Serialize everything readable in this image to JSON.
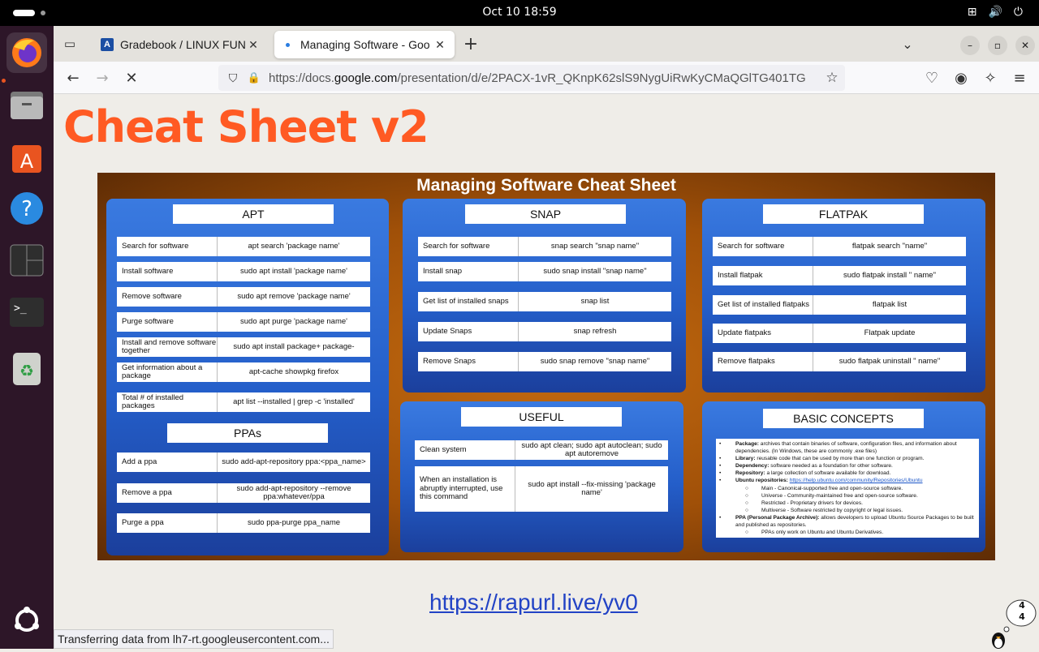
{
  "topbar": {
    "clock": "Oct 10  18:59"
  },
  "dock": {
    "apps": [
      "firefox-icon",
      "files-icon",
      "app-center-icon",
      "help-icon",
      "terminal-split-icon",
      "terminal-icon",
      "trash-icon",
      "ubuntu-grid-icon"
    ]
  },
  "browser": {
    "tabs": [
      {
        "title": "Gradebook / LINUX FUND",
        "close": "✕"
      },
      {
        "title": "Managing Software - Goo",
        "close": "✕"
      }
    ],
    "url_prefix": "https://docs.",
    "url_host": "google.com",
    "url_rest": "/presentation/d/e/2PACX-1vR_QKnpK62slS9NygUiRwKyCMaQGlTG401TG"
  },
  "slide": {
    "title": "Cheat Sheet v2",
    "sheet_title": "Managing Software Cheat Sheet",
    "apt": {
      "header": "APT",
      "rows": [
        {
          "label": "Search for software",
          "cmd": "apt search 'package name'"
        },
        {
          "label": "Install software",
          "cmd": "sudo apt install 'package name'"
        },
        {
          "label": "Remove software",
          "cmd": "sudo apt remove 'package name'"
        },
        {
          "label": "Purge software",
          "cmd": "sudo apt purge 'package name'"
        },
        {
          "label": "Install and remove software together",
          "cmd": "sudo apt install package+ package-"
        },
        {
          "label": "Get information about a package",
          "cmd": "apt-cache showpkg firefox"
        },
        {
          "label": "Total # of installed packages",
          "cmd": "apt list --installed | grep -c 'installed'"
        }
      ]
    },
    "ppas": {
      "header": "PPAs",
      "rows": [
        {
          "label": "Add a ppa",
          "cmd": "sudo add-apt-repository ppa:<ppa_name>"
        },
        {
          "label": "Remove a ppa",
          "cmd": "sudo add-apt-repository --remove ppa:whatever/ppa"
        },
        {
          "label": "Purge a ppa",
          "cmd": "sudo ppa-purge ppa_name"
        }
      ]
    },
    "snap": {
      "header": "SNAP",
      "rows": [
        {
          "label": "Search for software",
          "cmd": "snap search \"snap name\""
        },
        {
          "label": "Install snap",
          "cmd": "sudo snap install \"snap name\""
        },
        {
          "label": "Get list of installed snaps",
          "cmd": "snap list"
        },
        {
          "label": "Update Snaps",
          "cmd": "snap refresh"
        },
        {
          "label": "Remove Snaps",
          "cmd": "sudo snap remove \"snap name\""
        }
      ]
    },
    "flatpak": {
      "header": "FLATPAK",
      "rows": [
        {
          "label": "Search for software",
          "cmd": "flatpak search \"name\""
        },
        {
          "label": "Install flatpak",
          "cmd": "sudo flatpak install \" name\""
        },
        {
          "label": "Get list of installed flatpaks",
          "cmd": "flatpak list"
        },
        {
          "label": "Update flatpaks",
          "cmd": "Flatpak update"
        },
        {
          "label": "Remove flatpaks",
          "cmd": "sudo flatpak uninstall \" name\""
        }
      ]
    },
    "useful": {
      "header": "USEFUL",
      "rows": [
        {
          "label": "Clean system",
          "cmd": "sudo apt clean; sudo apt autoclean; sudo apt autoremove"
        },
        {
          "label": "When an installation is abruptly interrupted, use this command",
          "cmd": "sudo apt  install --fix-missing 'package name'"
        }
      ]
    },
    "concepts": {
      "header": "BASIC CONCEPTS",
      "items": [
        {
          "term": "Package:",
          "text": " archives that contain binaries of software, configuration files, and information about dependencies. (In Windows, these are commonly .exe files)"
        },
        {
          "term": "Library:",
          "text": " reusable code that can be used by more than one function or program."
        },
        {
          "term": "Dependency:",
          "text": " software needed as a foundation for other software."
        },
        {
          "term": "Repository:",
          "text": " a large collection of software available for download."
        },
        {
          "term": "Ubuntu repositories:",
          "text": " ",
          "link": "https://help.ubuntu.com/community/Repositories/Ubuntu"
        }
      ],
      "repo_subitems": [
        "Main - Canonical-supported free and open-source software.",
        "Universe - Community-maintained free and open-source software.",
        "Restricted - Proprietary drivers for devices.",
        "Multiverse - Software restricted by copyright or legal issues."
      ],
      "ppa_item": {
        "term": "PPA (Personal Package Archive):",
        "text": " allows developers to upload Ubuntu Source Packages to be built and published as repositories."
      },
      "ppa_sub": "PPAs only work on Ubuntu and Ubuntu Derivatives."
    },
    "short_link": "https://rapurl.live/yv0"
  },
  "status_bar": "Transferring data from lh7-rt.googleusercontent.com...",
  "mascot_badge": "4\n4"
}
